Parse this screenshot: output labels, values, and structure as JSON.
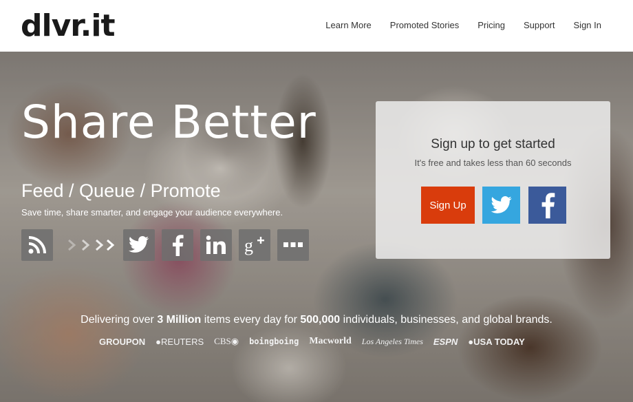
{
  "header": {
    "logo": "dlvr.it",
    "nav": [
      "Learn More",
      "Promoted Stories",
      "Pricing",
      "Support",
      "Sign In"
    ]
  },
  "hero": {
    "headline": "Share Better",
    "subhead": "Feed / Queue / Promote",
    "tagline": "Save time, share smarter, and engage your audience everywhere.",
    "channel_icons": [
      "rss-icon",
      "arrows-icon",
      "twitter-icon",
      "facebook-icon",
      "linkedin-icon",
      "google-plus-icon",
      "more-icon"
    ]
  },
  "signup_card": {
    "title": "Sign up to get started",
    "subtitle": "It's free and takes less than 60 seconds",
    "signup_label": "Sign Up",
    "colors": {
      "signup": "#d93c0c",
      "twitter": "#35a6df",
      "facebook": "#3b5a9a"
    }
  },
  "stats": {
    "prefix": "Delivering over ",
    "items": "3 Million",
    "middle": " items every day for ",
    "count": "500,000",
    "suffix": " individuals, businesses, and global brands."
  },
  "brands": [
    "GROUPON",
    "REUTERS",
    "CBS",
    "boingboing",
    "Macworld",
    "Los Angeles Times",
    "ESPN",
    "USA TODAY"
  ]
}
